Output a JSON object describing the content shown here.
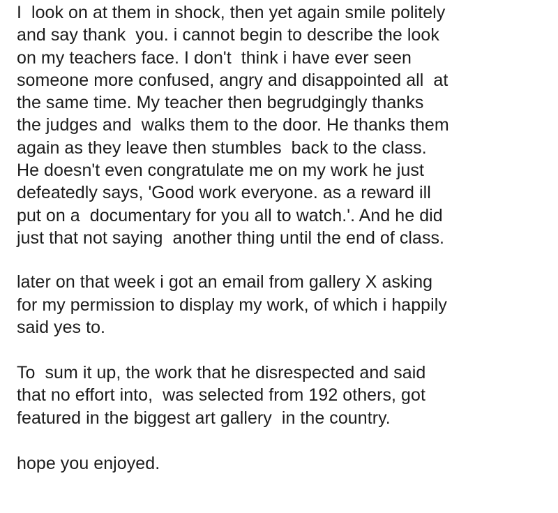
{
  "paragraphs": [
    {
      "lines": [
        "I  look on at them in shock, then yet again smile politely",
        "and say thank  you. i cannot begin to describe the look",
        "on my teachers face. I don't  think i have ever seen",
        "someone more confused, angry and disappointed all  at",
        "the same time. My teacher then begrudgingly thanks",
        "the judges and  walks them to the door. He thanks them",
        "again as they leave then stumbles  back to the class.",
        "He doesn't even congratulate me on my work he just",
        "defeatedly says, 'Good work everyone. as a reward ill",
        "put on a  documentary for you all to watch.'. And he did",
        "just that not saying  another thing until the end of class."
      ]
    },
    {
      "lines": [
        "later on that week i got an email from gallery X asking",
        "for my permission to display my work, of which i happily",
        "said yes to."
      ]
    },
    {
      "lines": [
        "To  sum it up, the work that he disrespected and said",
        "that no effort into,  was selected from 192 others, got",
        "featured in the biggest art gallery  in the country."
      ]
    },
    {
      "lines": [
        "hope you enjoyed."
      ]
    }
  ]
}
